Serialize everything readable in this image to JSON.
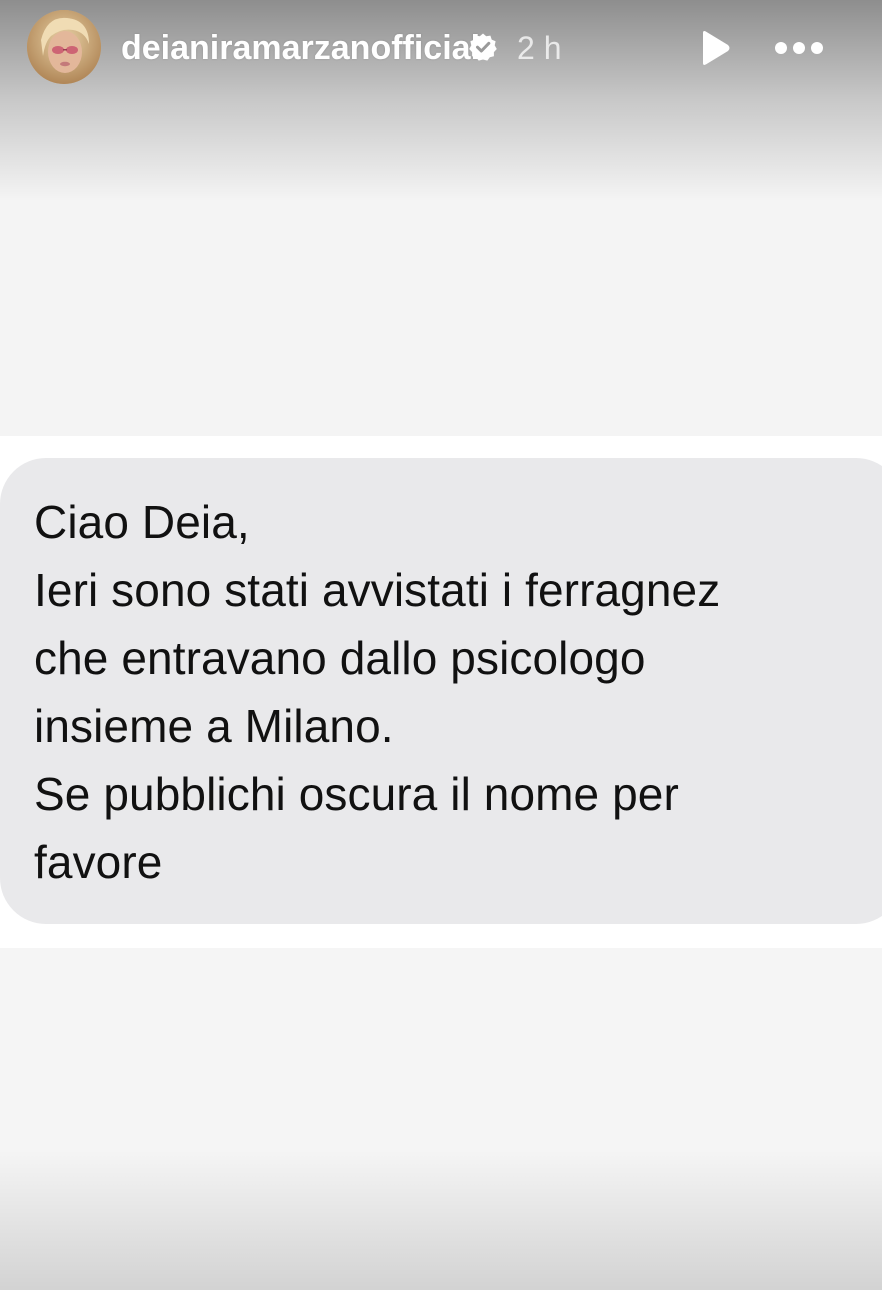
{
  "story": {
    "username": "deianiramarzanofficial",
    "verified": true,
    "time_ago": "2 h",
    "avatar_icon": "user-avatar",
    "play_icon": "play-icon",
    "more_icon": "more-horizontal-icon"
  },
  "message": {
    "lines": [
      "Ciao Deia,",
      "Ieri sono stati avvistati i ferragnez",
      "che entravano dallo psicologo",
      "insieme a Milano.",
      "Se pubblichi oscura il nome per",
      "favore"
    ]
  },
  "colors": {
    "bubble": "#e9e9eb",
    "text": "#111111",
    "background": "#f5f5f5"
  }
}
